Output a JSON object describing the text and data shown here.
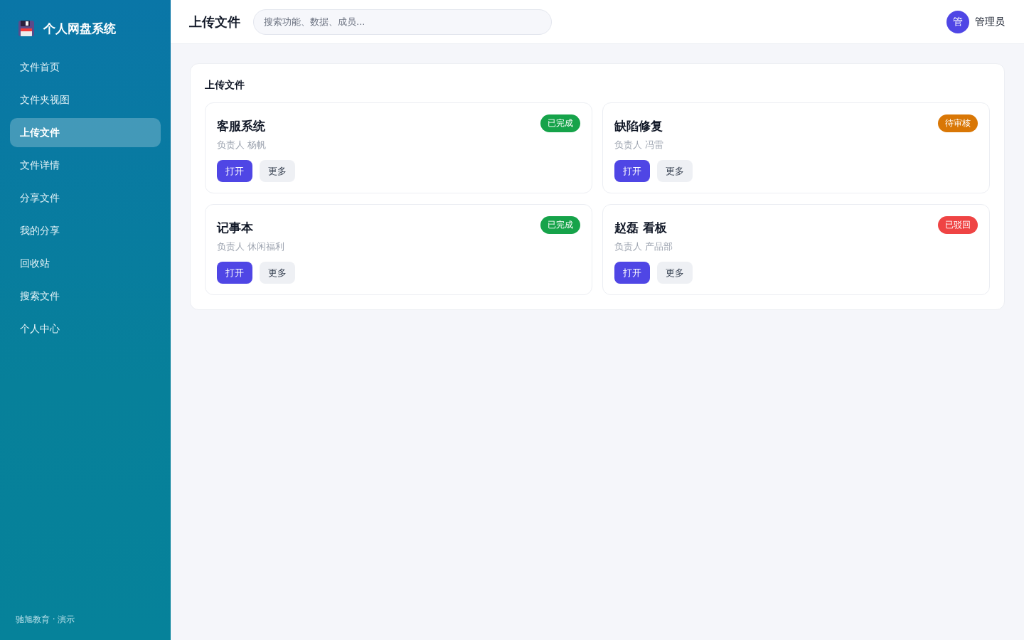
{
  "sidebar": {
    "brand": "个人网盘系统",
    "items": [
      {
        "label": "文件首页",
        "selected": false
      },
      {
        "label": "文件夹视图",
        "selected": false
      },
      {
        "label": "上传文件",
        "selected": true
      },
      {
        "label": "文件详情",
        "selected": false
      },
      {
        "label": "分享文件",
        "selected": false
      },
      {
        "label": "我的分享",
        "selected": false
      },
      {
        "label": "回收站",
        "selected": false
      },
      {
        "label": "搜索文件",
        "selected": false
      },
      {
        "label": "个人中心",
        "selected": false
      }
    ],
    "footer": "驰旭教育 · 演示"
  },
  "header": {
    "title": "上传文件",
    "search": {
      "placeholder": "搜索功能、数据、成员..."
    },
    "user": {
      "avatar": "管",
      "name": "管理员"
    }
  },
  "panel": {
    "title": "上传文件",
    "cards": [
      {
        "title": "客服系统",
        "owner": "负责人 杨帆",
        "status": {
          "label": "已完成",
          "color": "#16a34a"
        },
        "buttons": [
          {
            "label": "打开",
            "kind": "primary"
          },
          {
            "label": "更多",
            "kind": "secondary"
          }
        ]
      },
      {
        "title": "缺陷修复",
        "owner": "负责人 冯雷",
        "status": {
          "label": "待审核",
          "color": "#d97706"
        },
        "buttons": [
          {
            "label": "打开",
            "kind": "primary"
          },
          {
            "label": "更多",
            "kind": "secondary"
          }
        ]
      },
      {
        "title": "记事本",
        "owner": "负责人 休闲福利",
        "status": {
          "label": "已完成",
          "color": "#16a34a"
        },
        "buttons": [
          {
            "label": "打开",
            "kind": "primary"
          },
          {
            "label": "更多",
            "kind": "secondary"
          }
        ]
      },
      {
        "title": "赵磊 看板",
        "owner": "负责人 产品部",
        "status": {
          "label": "已驳回",
          "color": "#ef4444"
        },
        "buttons": [
          {
            "label": "打开",
            "kind": "primary"
          },
          {
            "label": "更多",
            "kind": "secondary"
          }
        ]
      }
    ]
  }
}
